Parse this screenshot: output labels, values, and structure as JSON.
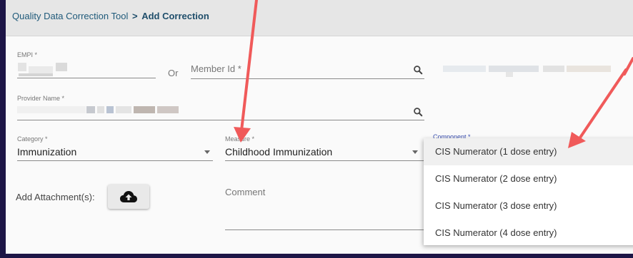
{
  "breadcrumb": {
    "parent": "Quality Data Correction Tool",
    "separator": ">",
    "current": "Add Correction"
  },
  "form": {
    "empi_label": "EMPI *",
    "or_text": "Or",
    "member_id_placeholder": "Member Id *",
    "provider_name_label": "Provider Name *",
    "category_label": "Category *",
    "category_value": "Immunization",
    "measure_label": "Measure *",
    "measure_value": "Childhood Immunization",
    "component_label": "Component *",
    "attachment_label": "Add Attachment(s):",
    "comment_placeholder": "Comment"
  },
  "component_dropdown": {
    "options": [
      "CIS Numerator (1 dose entry)",
      "CIS Numerator (2 dose entry)",
      "CIS Numerator (3 dose entry)",
      "CIS Numerator (4 dose entry)"
    ],
    "highlighted_index": 0
  },
  "icons": {
    "search": "search-icon",
    "upload": "cloud-upload-icon",
    "dropdown": "dropdown-arrow-icon"
  },
  "colors": {
    "window_border": "#1d1546",
    "header_bg": "#e6e6e6",
    "breadcrumb_text": "#1f5a7a",
    "annotation_arrow": "#f05a5a"
  }
}
